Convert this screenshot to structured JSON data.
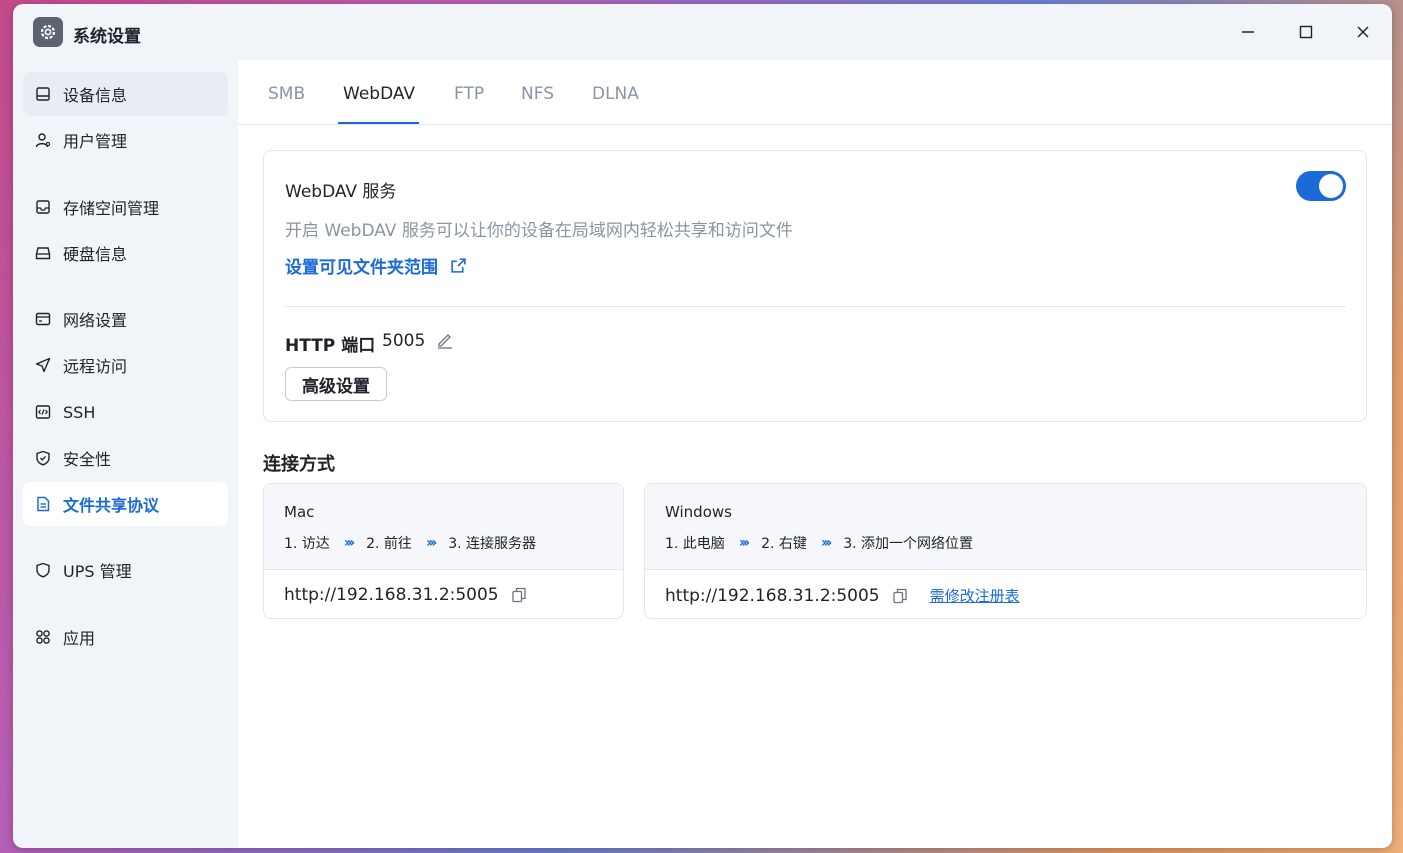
{
  "window": {
    "title": "系统设置"
  },
  "sidebar": {
    "items": [
      {
        "label": "设备信息",
        "icon": "device-icon"
      },
      {
        "label": "用户管理",
        "icon": "user-icon"
      },
      {
        "label": "存储空间管理",
        "icon": "storage-icon"
      },
      {
        "label": "硬盘信息",
        "icon": "disk-icon"
      },
      {
        "label": "网络设置",
        "icon": "network-icon"
      },
      {
        "label": "远程访问",
        "icon": "remote-icon"
      },
      {
        "label": "SSH",
        "icon": "ssh-icon"
      },
      {
        "label": "安全性",
        "icon": "shield-icon"
      },
      {
        "label": "文件共享协议",
        "icon": "file-icon",
        "active": true
      },
      {
        "label": "UPS 管理",
        "icon": "ups-icon"
      },
      {
        "label": "应用",
        "icon": "apps-icon"
      }
    ]
  },
  "tabs": [
    {
      "label": "SMB"
    },
    {
      "label": "WebDAV",
      "active": true
    },
    {
      "label": "FTP"
    },
    {
      "label": "NFS"
    },
    {
      "label": "DLNA"
    }
  ],
  "service": {
    "title": "WebDAV 服务",
    "enabled": true,
    "description": "开启 WebDAV 服务可以让你的设备在局域网内轻松共享和访问文件",
    "folder_link": "设置可见文件夹范围",
    "port_label": "HTTP 端口",
    "port_value": "5005",
    "advanced_button": "高级设置"
  },
  "connection": {
    "title": "连接方式",
    "mac": {
      "os": "Mac",
      "steps": [
        "1. 访达",
        "2. 前往",
        "3. 连接服务器"
      ],
      "url": "http://192.168.31.2:5005"
    },
    "windows": {
      "os": "Windows",
      "steps": [
        "1. 此电脑",
        "2. 右键",
        "3. 添加一个网络位置"
      ],
      "url": "http://192.168.31.2:5005",
      "registry_link": "需修改注册表"
    }
  },
  "colors": {
    "accent": "#1a6ad8",
    "muted_text": "#8a94a6",
    "sidebar_bg": "#f1f4f8"
  }
}
